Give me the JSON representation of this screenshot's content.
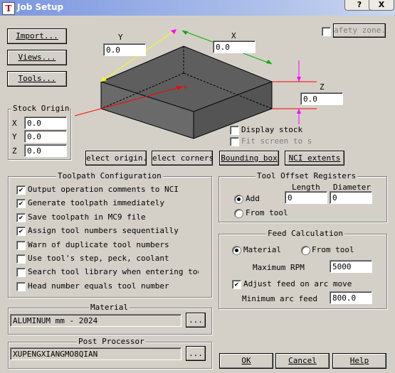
{
  "window": {
    "title": "Job Setup",
    "help_label": "?",
    "close_label": "X"
  },
  "left_buttons": {
    "import": "Import...",
    "views": "Views...",
    "tools": "Tools..."
  },
  "safety_zone": {
    "label": "afety zone..",
    "checked": false
  },
  "dims": {
    "y_label": "Y",
    "y_value": "0.0",
    "x_label": "X",
    "x_value": "0.0",
    "z_label": "Z",
    "z_value": "0.0"
  },
  "display_options": {
    "display_stock": "Display stock",
    "display_stock_checked": false,
    "fit_screen": "Fit screen to s",
    "fit_screen_checked": false
  },
  "stock_origin": {
    "title": "Stock Origin",
    "x_label": "X",
    "x_value": "0.0",
    "y_label": "Y",
    "y_value": "0.0",
    "z_label": "Z",
    "z_value": "0.0"
  },
  "stock_buttons": {
    "select_origin": "elect origin..",
    "select_corners": "elect corners..",
    "bounding_box": "Bounding box",
    "nci_extents": "NCI extents"
  },
  "toolpath_config": {
    "title": "Toolpath Configuration",
    "items": [
      {
        "label": "Output operation comments to NCI",
        "checked": true
      },
      {
        "label": "Generate toolpath immediately",
        "checked": true
      },
      {
        "label": "Save toolpath in MC9 file",
        "checked": true
      },
      {
        "label": "Assign tool numbers sequentially",
        "checked": true
      },
      {
        "label": "Warn of duplicate tool numbers",
        "checked": false
      },
      {
        "label": "Use tool's step, peck, coolant",
        "checked": false
      },
      {
        "label": "Search tool library when entering tool r",
        "checked": false
      },
      {
        "label": "Head number equals tool number",
        "checked": false
      }
    ],
    "check_glyph": "✔"
  },
  "tool_offset": {
    "title": "Tool Offset Registers",
    "length_label": "Length",
    "diameter_label": "Diameter",
    "add_label": "Add",
    "add_selected": true,
    "length_value": "0",
    "diameter_value": "0",
    "from_tool_label": "From tool",
    "from_tool_selected": false
  },
  "feed_calc": {
    "title": "Feed Calculation",
    "material_label": "Material",
    "material_selected": true,
    "from_tool_label": "From tool",
    "from_tool_selected": false,
    "max_rpm_label": "Maximum RPM",
    "max_rpm_value": "5000",
    "adjust_label": "Adjust feed on arc move",
    "adjust_checked": true,
    "min_arc_label": "Minimum arc feed",
    "min_arc_value": "800.0"
  },
  "material": {
    "title": "Material",
    "value": "ALUMINUM mm - 2024",
    "browse": "..."
  },
  "post_processor": {
    "title": "Post Processor",
    "value": "XUPENGXIANGMO8QIAN",
    "browse": "..."
  },
  "footer": {
    "ok": "OK",
    "cancel": "Cancel",
    "help": "Help"
  }
}
